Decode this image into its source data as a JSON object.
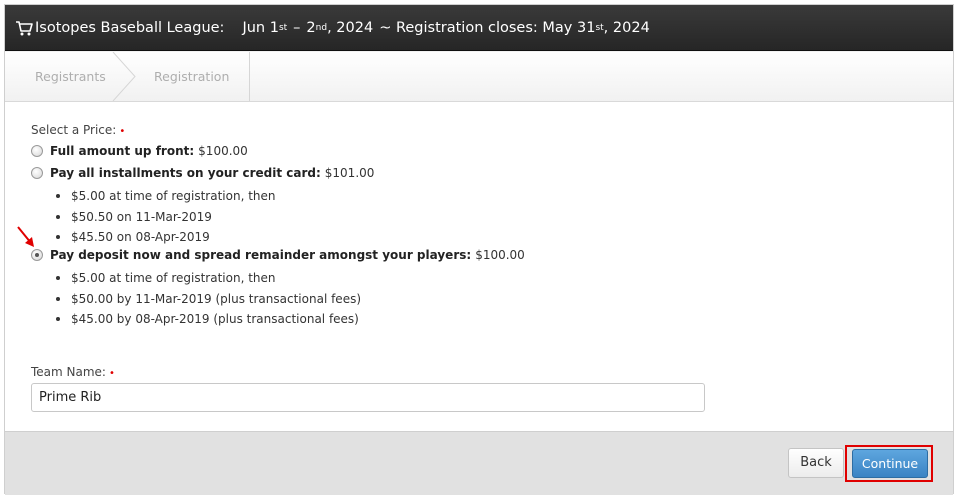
{
  "header": {
    "league": "Isotopes Baseball League:",
    "date_start_day": "Jun 1",
    "date_start_sup": "st",
    "date_sep": "–",
    "date_end_day": "2",
    "date_end_sup": "nd",
    "date_end_year": ", 2024",
    "close_prefix": "~ Registration closes: May 31",
    "close_sup": "st",
    "close_year": ", 2024"
  },
  "steps": [
    "Registrants",
    "Registration"
  ],
  "price": {
    "label": "Select a Price:",
    "required_mark": "•",
    "options": [
      {
        "title": "Full amount up front:",
        "amount": "$100.00",
        "selected": false,
        "details": []
      },
      {
        "title": "Pay all installments on your credit card:",
        "amount": "$101.00",
        "selected": false,
        "details": [
          "$5.00 at time of registration, then",
          "$50.50 on 11-Mar-2019",
          "$45.50 on 08-Apr-2019"
        ]
      },
      {
        "title": "Pay deposit now and spread remainder amongst your players:",
        "amount": "$100.00",
        "selected": true,
        "details": [
          "$5.00 at time of registration, then",
          "$50.00 by 11-Mar-2019 (plus transactional fees)",
          "$45.00 by 08-Apr-2019 (plus transactional fees)"
        ]
      }
    ]
  },
  "team": {
    "label": "Team Name:",
    "required_mark": "•",
    "value": "Prime Rib"
  },
  "buttons": {
    "back": "Back",
    "continue": "Continue"
  },
  "colors": {
    "highlight": "#e00000",
    "primary": "#3a83c4",
    "header_bg": "#262626"
  }
}
